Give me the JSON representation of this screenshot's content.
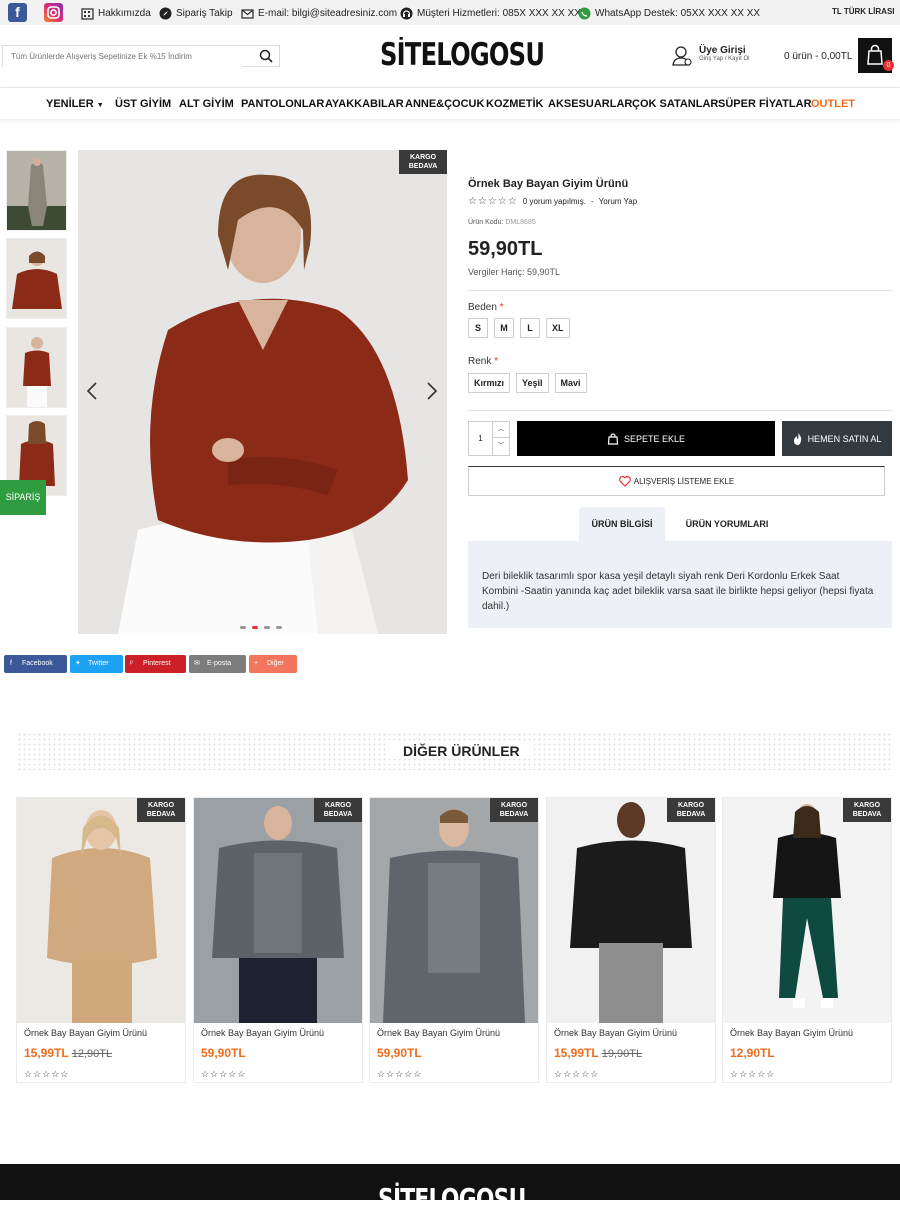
{
  "topbar": {
    "facebook_icon": "facebook-icon",
    "instagram_icon": "instagram-icon",
    "links": [
      {
        "label": "Hakkımızda",
        "icon": "building-icon"
      },
      {
        "label": "Sipariş Takip",
        "icon": "compass-icon"
      },
      {
        "label": "E-mail: bilgi@siteadresiniz.com",
        "icon": "mail-icon"
      },
      {
        "label": "Müşteri Hizmetleri: 085X XXX XX XX",
        "icon": "headset-icon"
      },
      {
        "label": "WhatsApp Destek: 05XX XXX XX XX",
        "icon": "whatsapp-icon"
      }
    ],
    "currency": "TL  TÜRK LİRASI"
  },
  "header": {
    "search_placeholder": "Tüm Ürünlerde Alışveriş Sepetinize Ek %15 İndirim",
    "logo": "SİTELOGOSU",
    "member_title": "Üye Girişi",
    "member_sub": "Giriş Yap / Kayıt Ol",
    "cart_text": "0 ürün - 0,00TL",
    "cart_count": "0"
  },
  "nav": {
    "items": [
      "YENİLER",
      "ÜST GİYİM",
      "ALT GİYİM",
      "PANTOLONLAR",
      "AYAKKABILAR",
      "ANNE&ÇOCUK",
      "KOZMETİK",
      "AKSESUARLAR",
      "ÇOK SATANLAR",
      "SÜPER FİYATLAR",
      "OUTLET"
    ]
  },
  "gallery": {
    "badge_line1": "KARGO",
    "badge_line2": "BEDAVA",
    "prev_icon": "chevron-left-icon",
    "next_icon": "chevron-right-icon"
  },
  "side_tab": "SİPARİŞ",
  "product": {
    "title": "Örnek Bay Bayan Giyim Ürünü",
    "stars": "☆☆☆☆☆",
    "reviews": "0 yorum yapılmış.",
    "sep": "-",
    "review_link": "Yorum Yap",
    "code_label": "Ürün Kodu:",
    "code": "DML8685",
    "price": "59,90TL",
    "tax_note": "Vergiler Hariç: 59,90TL",
    "size_label": "Beden",
    "sizes": [
      "S",
      "M",
      "L",
      "XL"
    ],
    "color_label": "Renk",
    "colors": [
      "Kırmızı",
      "Yeşil",
      "Mavi"
    ],
    "quantity": "1",
    "add_to_cart": "SEPETE EKLE",
    "buy_now": "HEMEN SATIN AL",
    "wishlist": "ALIŞVERİŞ LİSTEME EKLE",
    "tabs": [
      "ÜRÜN BİLGİSİ",
      "ÜRÜN YORUMLARI"
    ],
    "description": "Deri bileklik tasarımlı spor kasa yeşil detaylı siyah renk Deri Kordonlu Erkek Saat Kombini -Saatin yanında kaç adet bileklik varsa saat ile birlikte hepsi geliyor (hepsi fiyata dahil.)"
  },
  "share": [
    {
      "label": "Facebook",
      "color": "#3b5998"
    },
    {
      "label": "Twitter",
      "color": "#1da1f2"
    },
    {
      "label": "Pinterest",
      "color": "#cb2027"
    },
    {
      "label": "E-posta",
      "color": "#7d7d7d"
    },
    {
      "label": "Diğer",
      "color": "#f0775d"
    }
  ],
  "other_products": {
    "title": "DİĞER ÜRÜNLER",
    "items": [
      {
        "name": "Örnek Bay Bayan Giyim Ürünü",
        "price": "15,99TL",
        "old_price": "12,90TL",
        "stars": "☆☆☆☆☆"
      },
      {
        "name": "Örnek Bay Bayan Giyim Ürünü",
        "price": "59,90TL",
        "old_price": "",
        "stars": "☆☆☆☆☆"
      },
      {
        "name": "Örnek Bay Bayan Giyim Ürünü",
        "price": "59,90TL",
        "old_price": "",
        "stars": "☆☆☆☆☆"
      },
      {
        "name": "Örnek Bay Bayan Giyim Ürünü",
        "price": "15,99TL",
        "old_price": "19,90TL",
        "stars": "☆☆☆☆☆"
      },
      {
        "name": "Örnek Bay Bayan Giyim Ürünü",
        "price": "12,90TL",
        "old_price": "",
        "stars": "☆☆☆☆☆"
      }
    ]
  },
  "footer": {
    "logo": "SİTELOGOSU"
  },
  "colors": {
    "accent": "#f06b1c",
    "dark": "#111111",
    "required": "#e3322f",
    "whatsapp": "#2f9d3f"
  }
}
